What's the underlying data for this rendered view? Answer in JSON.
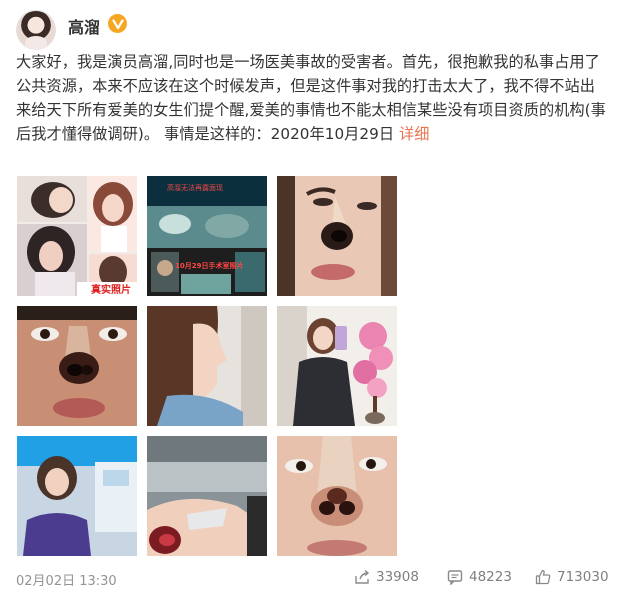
{
  "author": {
    "name": "高溜",
    "verified_badge": "v-badge-icon",
    "badge_color": "#f5a623"
  },
  "post": {
    "text": "大家好，我是演员高溜,同时也是一场医美事故的受害者。首先，很抱歉我的私事占用了公共资源，本来不应该在这个时候发声，但是这件事对我的打击太大了，我不得不站出来给天下所有爱美的女生们提个醒,爱美的事情也不能太相信某些没有项目资质的机构(事后我才懂得做调研)。 事情是这样的：2020年10月29日",
    "more_label": "详细",
    "link_color": "#eb7350"
  },
  "images": {
    "img2_line1": "高溜无法再露面现",
    "img2_line2": "10月29日手术室照片",
    "img1_caption": "真实照片"
  },
  "footer": {
    "timestamp": "02月02日 13:30",
    "share_count": "33908",
    "comment_count": "48223",
    "like_count": "713030"
  }
}
